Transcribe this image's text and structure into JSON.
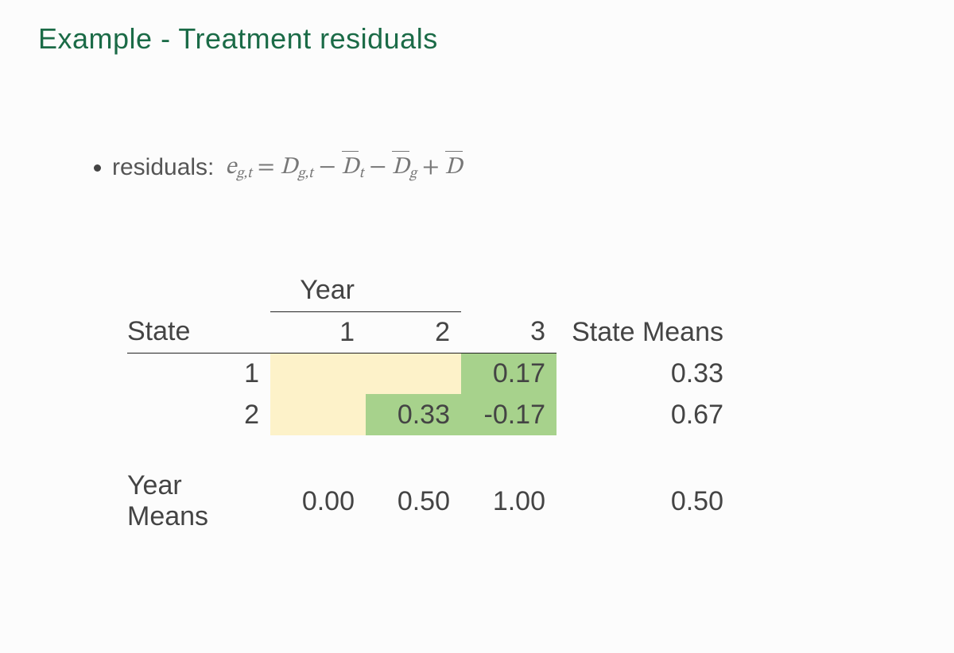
{
  "title": "Example - Treatment residuals",
  "bullet_label": "residuals:",
  "formula_html": "e<span class='sub'>g,t</span>&nbsp;<span class='rom'>=</span>&nbsp;D<span class='sub'>g,t</span>&nbsp;<span class='rom'>&minus;</span>&nbsp;<span class='bar'>D</span><span class='sub'>t</span>&nbsp;<span class='rom'>&minus;</span>&nbsp;<span class='bar'>D</span><span class='sub'>g</span>&nbsp;<span class='rom'>+</span>&nbsp;<span class='bar'>D</span>",
  "table": {
    "year_label": "Year",
    "state_label": "State",
    "year_cols": [
      "1",
      "2",
      "3"
    ],
    "state_means_label": "State Means",
    "rows": [
      {
        "state": "1",
        "cells": [
          "",
          "",
          "0.17"
        ],
        "state_mean": "0.33"
      },
      {
        "state": "2",
        "cells": [
          "",
          "0.33",
          "-0.17"
        ],
        "state_mean": "0.67"
      }
    ],
    "year_means_label": "Year Means",
    "year_means": [
      "0.00",
      "0.50",
      "1.00"
    ],
    "grand_mean": "0.50"
  }
}
